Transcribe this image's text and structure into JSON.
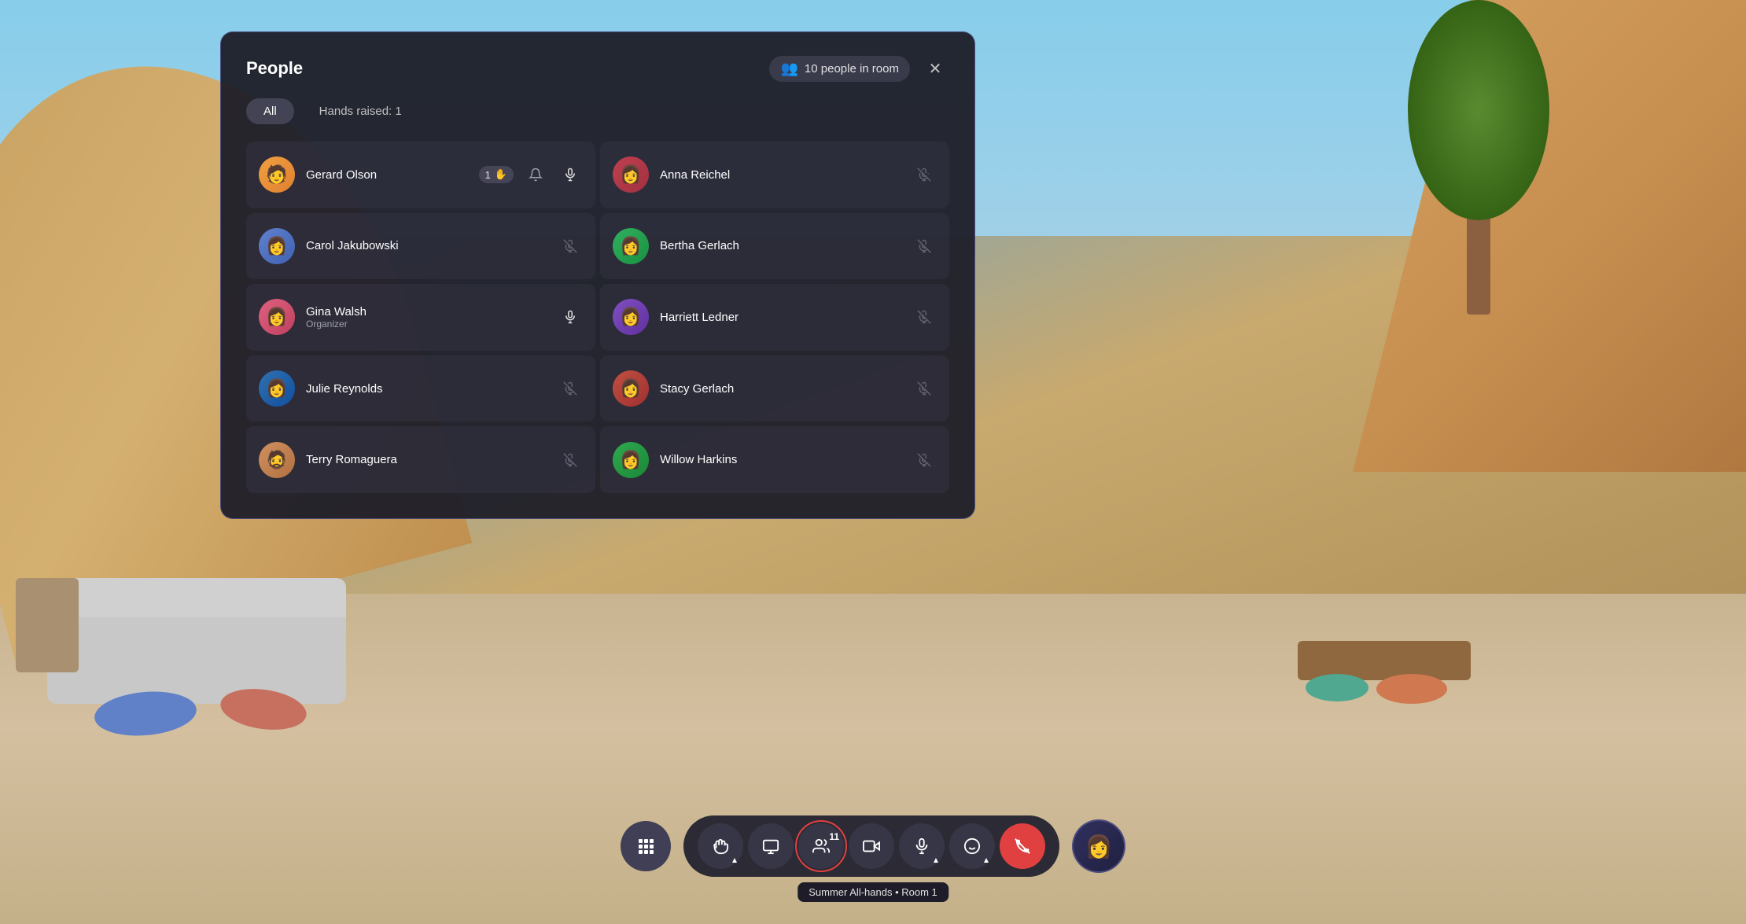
{
  "background": {
    "color": "#6b9ab8"
  },
  "panel": {
    "title": "People",
    "people_count": "10 people in room",
    "filters": {
      "all_label": "All",
      "hands_raised_label": "Hands raised: 1"
    },
    "people": [
      {
        "id": "gerard",
        "name": "Gerard Olson",
        "role": "",
        "hand_count": "1",
        "has_hand": true,
        "mic": "on",
        "avatar_color": "#f0a040",
        "col": 0
      },
      {
        "id": "anna",
        "name": "Anna Reichel",
        "role": "",
        "has_hand": false,
        "mic": "off",
        "avatar_color": "#c04050",
        "col": 1
      },
      {
        "id": "carol",
        "name": "Carol Jakubowski",
        "role": "",
        "has_hand": false,
        "mic": "off",
        "avatar_color": "#6080d0",
        "col": 0
      },
      {
        "id": "bertha",
        "name": "Bertha Gerlach",
        "role": "",
        "has_hand": false,
        "mic": "off",
        "avatar_color": "#30b060",
        "col": 1
      },
      {
        "id": "gina",
        "name": "Gina Walsh",
        "role": "Organizer",
        "has_hand": false,
        "mic": "on",
        "avatar_color": "#e06080",
        "col": 0
      },
      {
        "id": "harriett",
        "name": "Harriett Ledner",
        "role": "",
        "has_hand": false,
        "mic": "off",
        "avatar_color": "#8050c0",
        "col": 1
      },
      {
        "id": "julie",
        "name": "Julie Reynolds",
        "role": "",
        "has_hand": false,
        "mic": "off",
        "avatar_color": "#3070b0",
        "col": 0
      },
      {
        "id": "stacy",
        "name": "Stacy Gerlach",
        "role": "",
        "has_hand": false,
        "mic": "off",
        "avatar_color": "#c05040",
        "col": 1
      },
      {
        "id": "terry",
        "name": "Terry Romaguera",
        "role": "",
        "has_hand": false,
        "mic": "off",
        "avatar_color": "#d09060",
        "col": 0
      },
      {
        "id": "willow",
        "name": "Willow Harkins",
        "role": "",
        "has_hand": false,
        "mic": "off",
        "avatar_color": "#30a850",
        "col": 1
      }
    ]
  },
  "toolbar": {
    "grid_btn_icon": "⊞",
    "share_btn_icon": "↑",
    "slides_btn_icon": "▭",
    "people_btn_icon": "👤",
    "people_count": "11",
    "camera_btn_icon": "📷",
    "mic_btn_icon": "🎙",
    "emoji_btn_icon": "😊",
    "end_btn_icon": "📵",
    "tooltip": "Summer All-hands • Room 1"
  },
  "avatars": {
    "gerard": "🧑",
    "carol": "👩",
    "gina": "👩",
    "julie": "👩",
    "terry": "🧔",
    "anna": "👩",
    "bertha": "👩",
    "harriett": "👩",
    "stacy": "👩",
    "willow": "👩",
    "self": "👩"
  }
}
